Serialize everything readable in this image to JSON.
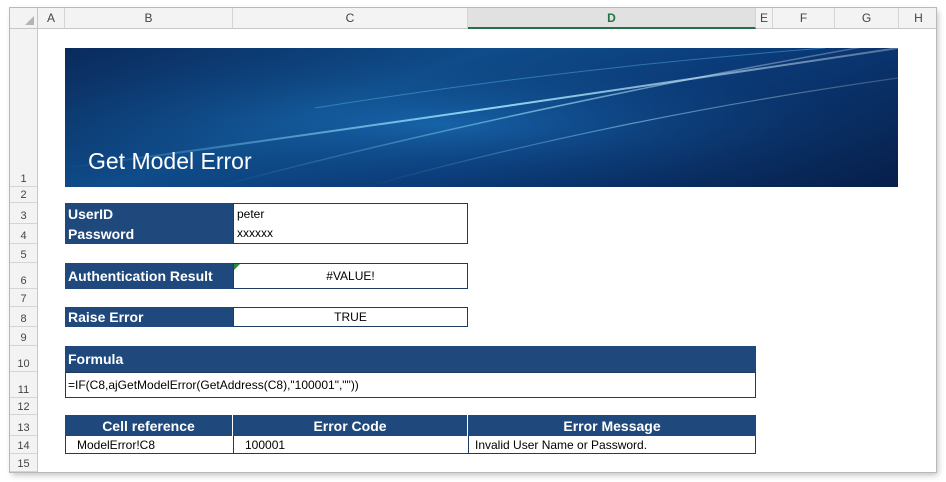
{
  "columns": [
    "A",
    "B",
    "C",
    "D",
    "E",
    "F",
    "G",
    "H"
  ],
  "selected_column": "D",
  "rows": [
    "1",
    "2",
    "3",
    "4",
    "5",
    "6",
    "7",
    "8",
    "9",
    "10",
    "11",
    "12",
    "13",
    "14",
    "15"
  ],
  "banner": {
    "title": "Get Model Error"
  },
  "login": {
    "userid_label": "UserID",
    "userid_value": "peter",
    "password_label": "Password",
    "password_value": "xxxxxx"
  },
  "auth": {
    "label": "Authentication Result",
    "value": "#VALUE!"
  },
  "raise": {
    "label": "Raise Error",
    "value": "TRUE"
  },
  "formula": {
    "label": "Formula",
    "text": "=IF(C8,ajGetModelError(GetAddress(C8),\"100001\",\"\"))"
  },
  "error_table": {
    "headers": [
      "Cell reference",
      "Error Code",
      "Error Message"
    ],
    "row": [
      "ModelError!C8",
      "100001",
      "Invalid User Name or Password."
    ]
  },
  "colors": {
    "header_blue": "#1f497d",
    "selected_green": "#217346"
  }
}
